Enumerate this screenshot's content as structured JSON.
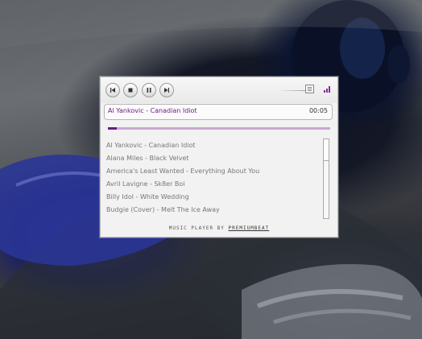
{
  "player": {
    "now_playing": {
      "title": "Al Yankovic - Canadian Idiot",
      "time": "00:05"
    },
    "progress_fraction": 0.04,
    "volume_fraction": 0.95,
    "playlist": [
      {
        "label": "Al Yankovic - Canadian Idiot"
      },
      {
        "label": "Alana Miles - Black Velvet"
      },
      {
        "label": "America's Least Wanted - Everything About You"
      },
      {
        "label": "Avril Lavigne - Sk8er Boi"
      },
      {
        "label": "Billy Idol - White Wedding"
      },
      {
        "label": "Budgie (Cover) - Melt The Ice Away"
      }
    ],
    "footer": {
      "prefix": "MUSIC PLAYER BY ",
      "brand": "PREMIUMBEAT"
    },
    "icons": {
      "previous": "previous-icon",
      "stop": "stop-icon",
      "pause": "pause-icon",
      "next": "next-icon",
      "volume": "volume-bars-icon"
    },
    "colors": {
      "accent": "#6d1c85",
      "progress_track": "#c9a7d1",
      "progress_fill": "#6a1a82"
    }
  }
}
